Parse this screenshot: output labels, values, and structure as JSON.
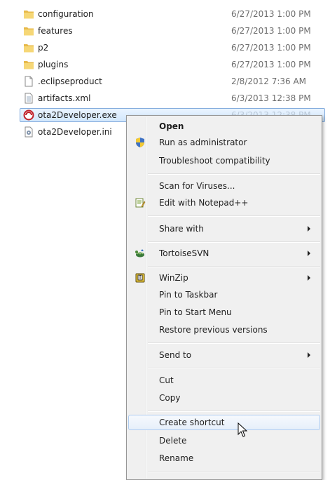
{
  "files": [
    {
      "name": "configuration",
      "date": "6/27/2013 1:00 PM",
      "icon": "folder-icon"
    },
    {
      "name": "features",
      "date": "6/27/2013 1:00 PM",
      "icon": "folder-icon"
    },
    {
      "name": "p2",
      "date": "6/27/2013 1:00 PM",
      "icon": "folder-icon"
    },
    {
      "name": "plugins",
      "date": "6/27/2013 1:00 PM",
      "icon": "folder-icon"
    },
    {
      "name": ".eclipseproduct",
      "date": "2/8/2012 7:36 AM",
      "icon": "blank-file-icon"
    },
    {
      "name": "artifacts.xml",
      "date": "6/3/2013 12:38 PM",
      "icon": "text-file-icon"
    },
    {
      "name": "ota2Developer.exe",
      "date": "6/3/2013 12:38 PM",
      "icon": "app-exe-icon"
    },
    {
      "name": "ota2Developer.ini",
      "date": "",
      "icon": "config-file-icon"
    }
  ],
  "menu": {
    "open": "Open",
    "run_as_admin": "Run as administrator",
    "troubleshoot": "Troubleshoot compatibility",
    "scan": "Scan for Viruses...",
    "edit_notepad": "Edit with Notepad++",
    "share_with": "Share with",
    "tortoisesvn": "TortoiseSVN",
    "winzip": "WinZip",
    "pin_taskbar": "Pin to Taskbar",
    "pin_start": "Pin to Start Menu",
    "restore": "Restore previous versions",
    "send_to": "Send to",
    "cut": "Cut",
    "copy": "Copy",
    "create_shortcut": "Create shortcut",
    "delete": "Delete",
    "rename": "Rename"
  },
  "colors": {
    "selection_border": "#84acdd",
    "hover_border": "#aeccf0",
    "menu_bg": "#f0f0f0"
  }
}
